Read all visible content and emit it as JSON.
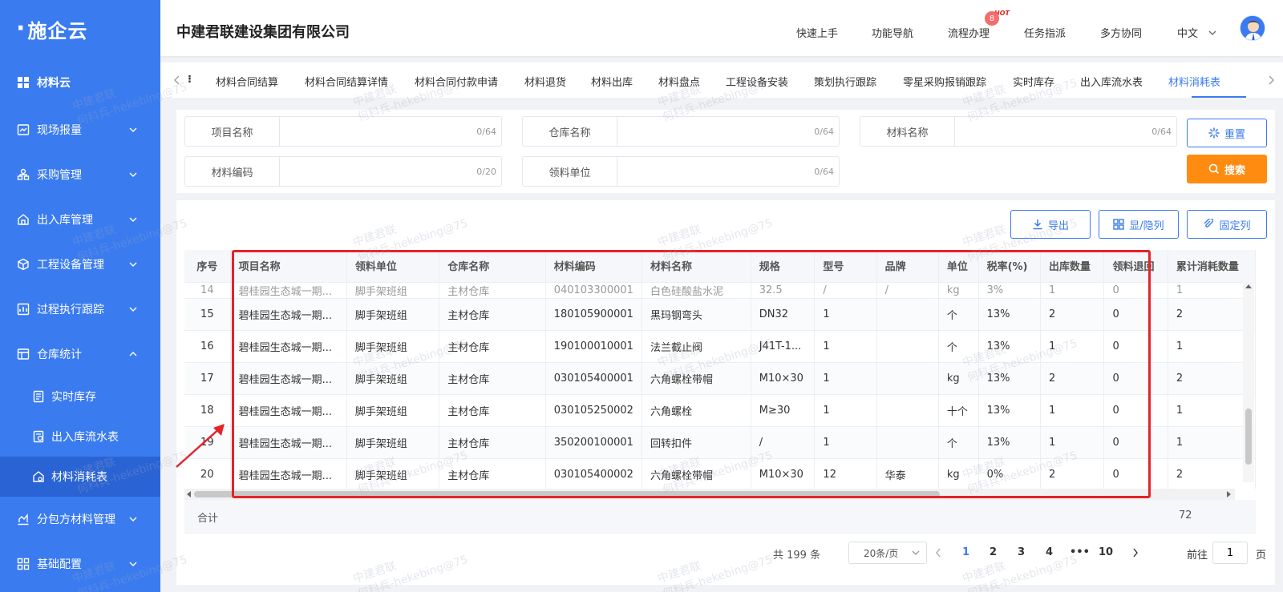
{
  "logo": {
    "text": "施企云"
  },
  "sidebar": {
    "items": [
      {
        "label": "材料云",
        "icon": "grid-icon"
      },
      {
        "label": "现场报量",
        "icon": "report-icon"
      },
      {
        "label": "采购管理",
        "icon": "org-icon"
      },
      {
        "label": "出入库管理",
        "icon": "home-icon"
      },
      {
        "label": "工程设备管理",
        "icon": "cube-icon"
      },
      {
        "label": "过程执行跟踪",
        "icon": "track-icon"
      },
      {
        "label": "仓库统计",
        "icon": "stats-icon"
      },
      {
        "label": "实时库存",
        "icon": "doc-icon"
      },
      {
        "label": "出入库流水表",
        "icon": "ledger-icon"
      },
      {
        "label": "材料消耗表",
        "icon": "consume-icon"
      },
      {
        "label": "分包方材料管理",
        "icon": "chart-icon"
      },
      {
        "label": "基础配置",
        "icon": "settings-icon"
      }
    ]
  },
  "header": {
    "company": "中建君联建设集团有限公司",
    "links": [
      "快速上手",
      "功能导航",
      "流程办理",
      "任务指派",
      "多方协同",
      "中文"
    ],
    "hot": "HOT",
    "badge": "8"
  },
  "tabs": [
    "材料合同结算",
    "材料合同结算详情",
    "材料合同付款申请",
    "材料退货",
    "材料出库",
    "材料盘点",
    "工程设备安装",
    "策划执行跟踪",
    "零星采购报销跟踪",
    "实时库存",
    "出入库流水表",
    "材料消耗表"
  ],
  "filters": {
    "project": {
      "label": "项目名称",
      "count": "0/64"
    },
    "warehouse": {
      "label": "仓库名称",
      "count": "0/64"
    },
    "material": {
      "label": "材料名称",
      "count": "0/64"
    },
    "code": {
      "label": "材料编码",
      "count": "0/20"
    },
    "unit": {
      "label": "领料单位",
      "count": "0/64"
    },
    "reset": "重置",
    "search": "搜索"
  },
  "actions": {
    "export": "导出",
    "toggle_cols": "显/隐列",
    "pin_cols": "固定列"
  },
  "table": {
    "columns": [
      "序号",
      "项目名称",
      "领料单位",
      "仓库名称",
      "材料编码",
      "材料名称",
      "规格",
      "型号",
      "品牌",
      "单位",
      "税率(%)",
      "出库数量",
      "领料退回",
      "累计消耗数量"
    ],
    "partial_row": [
      "14",
      "碧桂园生态城一期...",
      "脚手架班组",
      "主材仓库",
      "040103300001",
      "白色硅酸盐水泥",
      "32.5",
      "/",
      "/",
      "kg",
      "3%",
      "1",
      "0",
      "1"
    ],
    "rows": [
      [
        "15",
        "碧桂园生态城一期...",
        "脚手架班组",
        "主材仓库",
        "180105900001",
        "黑玛钢弯头",
        "DN32",
        "1",
        "",
        "个",
        "13%",
        "2",
        "0",
        "2"
      ],
      [
        "16",
        "碧桂园生态城一期...",
        "脚手架班组",
        "主材仓库",
        "190100010001",
        "法兰截止阀",
        "J41T-1...",
        "1",
        "",
        "个",
        "13%",
        "1",
        "0",
        "1"
      ],
      [
        "17",
        "碧桂园生态城一期...",
        "脚手架班组",
        "主材仓库",
        "030105400001",
        "六角螺栓带帽",
        "M10×30",
        "1",
        "",
        "kg",
        "13%",
        "2",
        "0",
        "2"
      ],
      [
        "18",
        "碧桂园生态城一期...",
        "脚手架班组",
        "主材仓库",
        "030105250002",
        "六角螺栓",
        "M≥30",
        "1",
        "",
        "十个",
        "13%",
        "1",
        "0",
        "1"
      ],
      [
        "19",
        "碧桂园生态城一期...",
        "脚手架班组",
        "主材仓库",
        "350200100001",
        "回转扣件",
        "/",
        "1",
        "",
        "个",
        "13%",
        "1",
        "0",
        "1"
      ],
      [
        "20",
        "碧桂园生态城一期...",
        "脚手架班组",
        "主材仓库",
        "030105400002",
        "六角螺栓带帽",
        "M10×30",
        "12",
        "华泰",
        "kg",
        "0%",
        "2",
        "0",
        "2"
      ]
    ],
    "total_label": "合计",
    "total_value": "72"
  },
  "pagination": {
    "total": "共 199 条",
    "page_size": "20条/页",
    "pages": [
      "1",
      "2",
      "3",
      "4",
      "•••",
      "10"
    ],
    "current": "1",
    "goto_label": "前往",
    "goto_value": "1",
    "page_suffix": "页"
  },
  "watermark": {
    "line1": "中建君联",
    "line2": "何科兵-hekebing@75"
  },
  "colors": {
    "primary": "#3a7bf0",
    "orange": "#ff8c11",
    "highlight_box": "#e4232a"
  }
}
